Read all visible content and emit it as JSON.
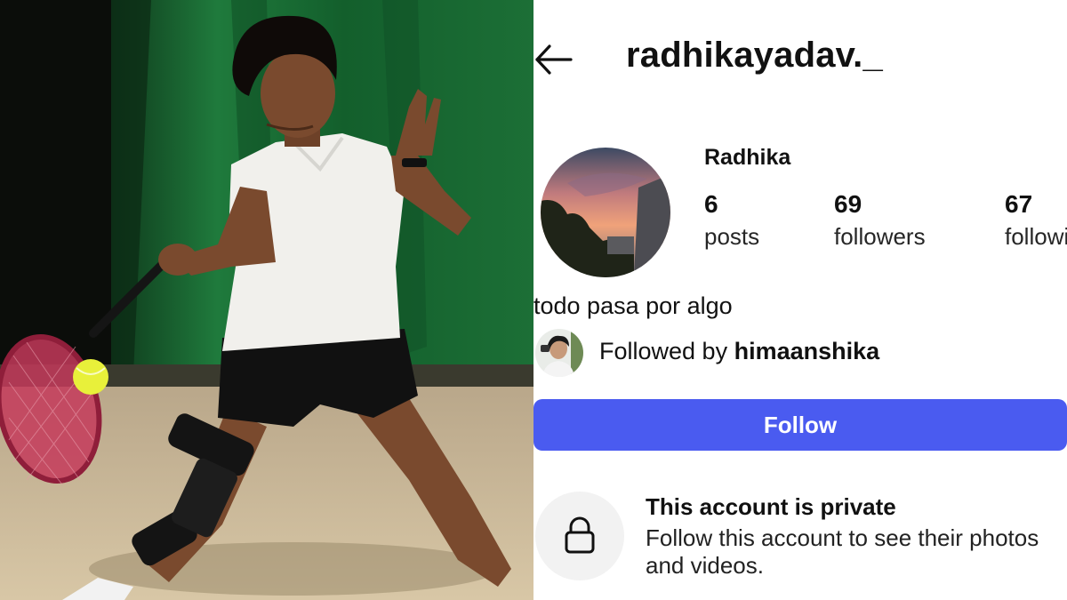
{
  "profile": {
    "username": "radhikayadav._",
    "display_name": "Radhika",
    "stats": [
      {
        "value": "6",
        "label": "posts"
      },
      {
        "value": "69",
        "label": "followers"
      },
      {
        "value": "67",
        "label": "following"
      }
    ],
    "bio": "todo pasa por algo",
    "followed_by_prefix": "Followed by ",
    "followed_by_user": "himaanshika",
    "follow_label": "Follow",
    "private_title": "This account is private",
    "private_desc": "Follow this account to see their photos and videos."
  },
  "icons": {
    "back": "arrow-left-icon",
    "lock": "lock-icon"
  },
  "colors": {
    "follow_button": "#4a5bf0",
    "lock_circle_bg": "#f2f2f2"
  }
}
